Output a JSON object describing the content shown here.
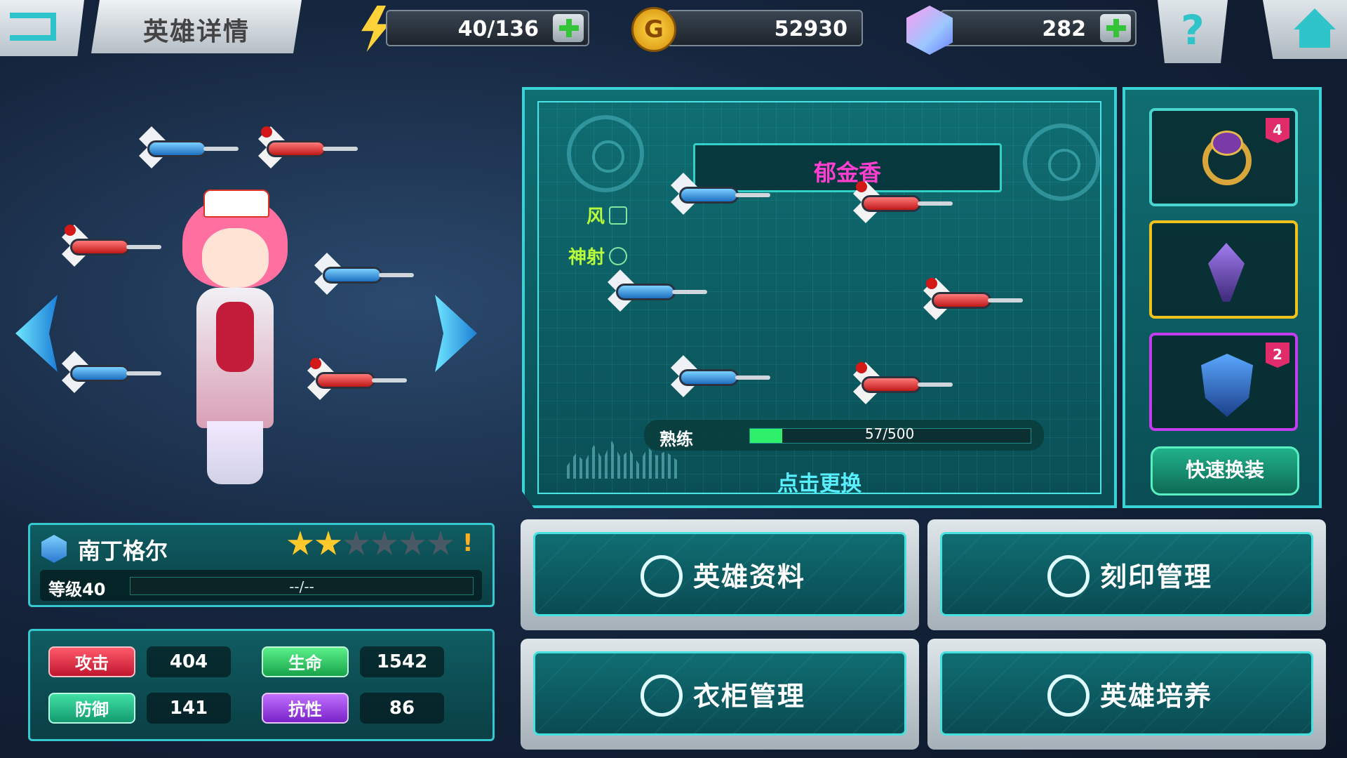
{
  "header": {
    "back_icon": "back-arrow-icon",
    "title": "英雄详情",
    "energy": {
      "icon": "lightning-icon",
      "value": "40/136"
    },
    "gold": {
      "icon": "gold-coin-icon",
      "coin_letter": "G",
      "value": "52930"
    },
    "gems": {
      "icon": "crystal-gem-icon",
      "value": "282"
    },
    "help_label": "?",
    "home_icon": "home-icon"
  },
  "character": {
    "prev_icon": "chevron-left-icon",
    "next_icon": "chevron-right-icon"
  },
  "weapon": {
    "name": "郁金香",
    "attributes": [
      {
        "label": "风",
        "icon": "wind-icon"
      },
      {
        "label": "神射",
        "icon": "crosshair-icon"
      }
    ],
    "proficiency": {
      "label": "熟练",
      "current": 57,
      "max": 500,
      "text": "57/500"
    },
    "change_hint": "点击更换"
  },
  "equipment": {
    "slots": [
      {
        "item": "ring",
        "badge": "4",
        "border": "#4ad6cf"
      },
      {
        "item": "jewel",
        "badge": "",
        "border": "#f1c21b"
      },
      {
        "item": "shield",
        "badge": "2",
        "border": "#c43cf0"
      }
    ],
    "quick_equip_label": "快速换装"
  },
  "hero": {
    "name": "南丁格尔",
    "stars_total": 6,
    "stars_filled": 2,
    "alert": "!",
    "level": "等级40",
    "exp_text": "--/--"
  },
  "stats": [
    {
      "label": "攻击",
      "value": "404",
      "color": "red"
    },
    {
      "label": "生命",
      "value": "1542",
      "color": "green"
    },
    {
      "label": "防御",
      "value": "141",
      "color": "teal"
    },
    {
      "label": "抗性",
      "value": "86",
      "color": "purple"
    }
  ],
  "menu": [
    {
      "label": "英雄资料",
      "icon": "hero-profile-icon"
    },
    {
      "label": "刻印管理",
      "icon": "engraving-icon"
    },
    {
      "label": "衣柜管理",
      "icon": "wardrobe-icon"
    },
    {
      "label": "英雄培养",
      "icon": "hero-training-icon"
    }
  ],
  "colors": {
    "accent_cyan": "#39d3d6",
    "weapon_name": "#ff3fcf",
    "attribute_text": "#b9ff3a",
    "proficiency_fill": "#2ff06a"
  }
}
